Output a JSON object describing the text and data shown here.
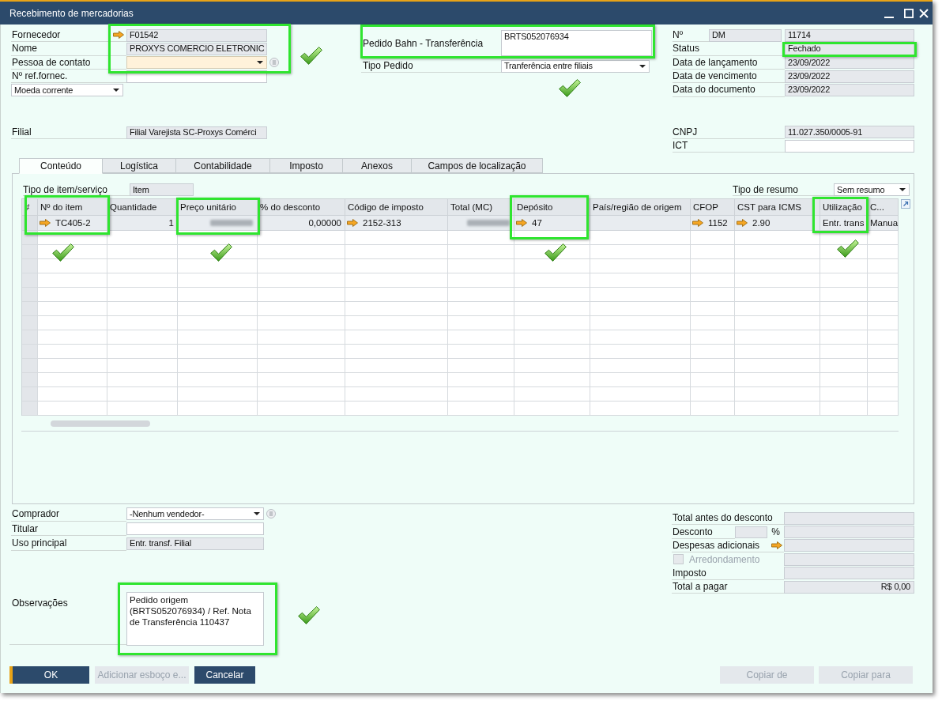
{
  "window": {
    "title": "Recebimento de mercadorias"
  },
  "vendor": [
    {
      "label": "Fornecedor",
      "kind": "link",
      "value": "F01542",
      "focused": false
    },
    {
      "label": "Nome",
      "kind": "readonly",
      "value": "PROXYS COMERCIO ELETRONIC",
      "focused": false
    },
    {
      "label": "Pessoa de contato",
      "kind": "select_lookup",
      "focused": true
    },
    {
      "label": "Nº ref.fornec.",
      "kind": "input",
      "focused": false
    }
  ],
  "currency": {
    "value": "Moeda corrente"
  },
  "branch": {
    "label": "Filial",
    "value": "Filial Varejista SC-Proxys Comérci"
  },
  "order": [
    {
      "label": "Pedido Bahn - Transferência",
      "kind": "textarea",
      "value": "BRTS052076934"
    },
    {
      "label": "Tipo Pedido",
      "kind": "select",
      "value": "Tranferência entre filiais"
    }
  ],
  "document": [
    {
      "label": "Nº",
      "series": "DM",
      "value": "11714"
    },
    {
      "label": "Status",
      "value": "Fechado"
    },
    {
      "label": "Data de lançamento",
      "value": "23/09/2022"
    },
    {
      "label": "Data de vencimento",
      "value": "23/09/2022"
    },
    {
      "label": "Data do documento",
      "value": "23/09/2022"
    }
  ],
  "tax_ids": [
    {
      "label": "CNPJ",
      "kind": "readonly",
      "value": "11.027.350/0005-91"
    },
    {
      "label": "ICT",
      "kind": "input"
    }
  ],
  "tabs": [
    {
      "label": "Conteúdo",
      "selected": true
    },
    {
      "label": "Logística",
      "selected": false
    },
    {
      "label": "Contabilidade",
      "selected": false
    },
    {
      "label": "Imposto",
      "selected": false
    },
    {
      "label": "Anexos",
      "selected": false
    },
    {
      "label": "Campos de localização",
      "selected": false
    }
  ],
  "content": {
    "item_type": {
      "label": "Tipo de item/serviço",
      "value": "Item"
    },
    "summary_type": {
      "label": "Tipo de resumo",
      "value": "Sem resumo"
    },
    "table": {
      "columns": [
        "#",
        "Nº do item",
        "Quantidade",
        "Preço unitário",
        "% do desconto",
        "Código de imposto",
        "Total (MC)",
        "Depósito",
        "País/região de origem",
        "CFOP",
        "CST para ICMS",
        "Utilização",
        "C..."
      ],
      "rows": [
        {
          "cells": [
            {
              "kind": "empty"
            },
            {
              "kind": "link",
              "text": "TC405-2"
            },
            {
              "kind": "number",
              "text": "1"
            },
            {
              "kind": "blurred"
            },
            {
              "kind": "number",
              "text": "0,00000"
            },
            {
              "kind": "link",
              "text": "2152-313"
            },
            {
              "kind": "blurred"
            },
            {
              "kind": "link",
              "text": "47"
            },
            {
              "kind": "empty"
            },
            {
              "kind": "link",
              "text": "1152"
            },
            {
              "kind": "link",
              "text": "2.90"
            },
            {
              "kind": "text",
              "text": "Entr. trans"
            },
            {
              "kind": "text",
              "text": "Manua"
            }
          ]
        }
      ]
    }
  },
  "purchase_info": [
    {
      "label": "Comprador",
      "kind": "select_lookup",
      "value": "-Nenhum vendedor-"
    },
    {
      "label": "Titular",
      "kind": "input"
    },
    {
      "label": "Uso principal",
      "kind": "readonly",
      "value": "Entr. transf. Filial"
    }
  ],
  "remarks": {
    "label": "Observações",
    "value": "Pedido origem (BRTS052076934) / Ref. Nota de Transferência 110437"
  },
  "totals": [
    {
      "kind": "amount",
      "label": "Total antes do desconto"
    },
    {
      "kind": "discount",
      "label": "Desconto",
      "unit": "%"
    },
    {
      "kind": "link",
      "label": "Despesas adicionais"
    },
    {
      "kind": "checkbox",
      "label": "Arredondamento",
      "checked": false,
      "disabled": true
    },
    {
      "kind": "amount",
      "label": "Imposto"
    },
    {
      "kind": "amount",
      "label": "Total a pagar",
      "value": "R$ 0,00"
    }
  ],
  "buttons_left": [
    {
      "label": "OK",
      "default": true,
      "disabled": false
    },
    {
      "label": "Adicionar esboço e...",
      "default": false,
      "disabled": true
    },
    {
      "label": "Cancelar",
      "default": false,
      "disabled": false
    }
  ],
  "buttons_right": [
    {
      "label": "Copiar de",
      "disabled": true
    },
    {
      "label": "Copiar para",
      "disabled": true
    }
  ]
}
